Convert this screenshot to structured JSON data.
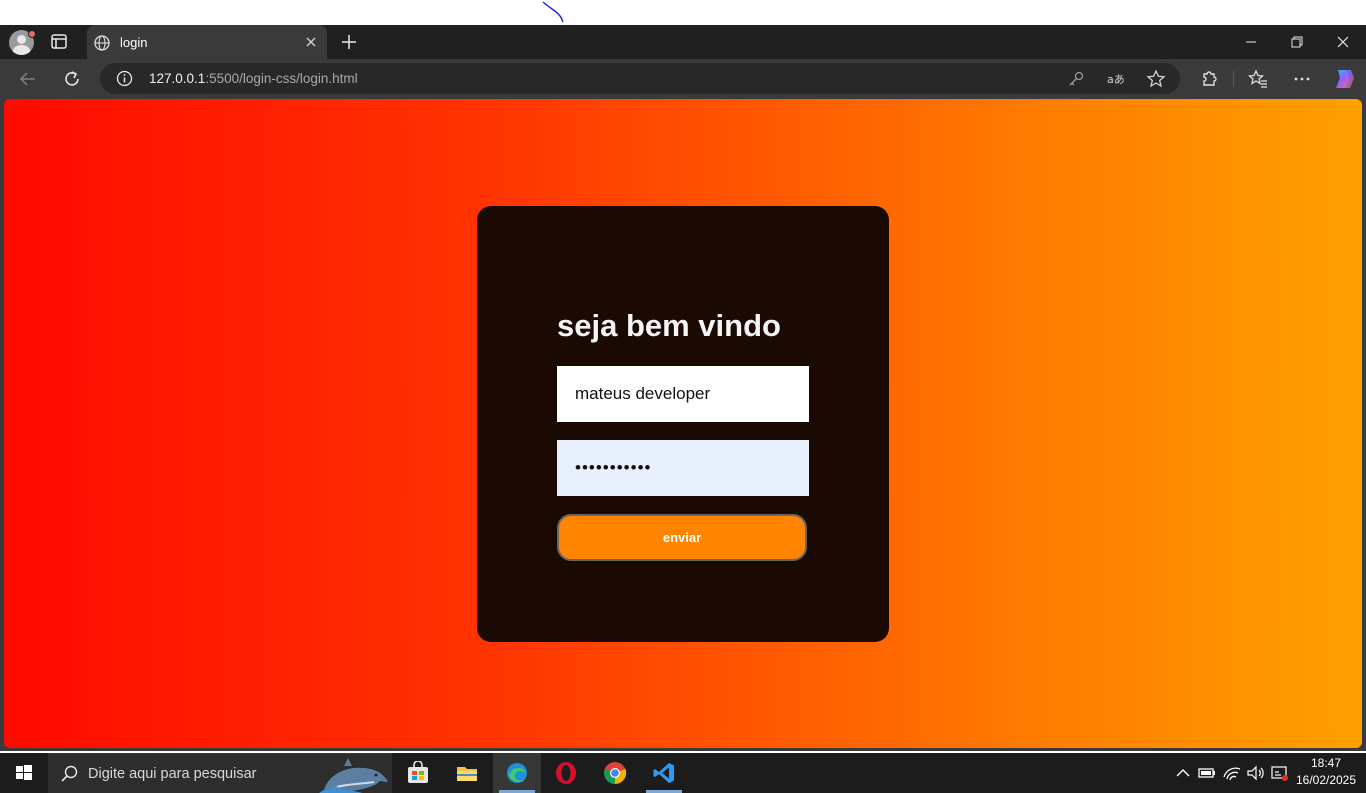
{
  "browser": {
    "tab": {
      "title": "login"
    },
    "address": {
      "host": "127.0.0.1",
      "path": ":5500/login-css/login.html"
    }
  },
  "page": {
    "title": "seja bem vindo",
    "username_value": "mateus developer",
    "password_value": "•••••••••••",
    "submit_label": "enviar",
    "colors": {
      "gradient_start": "#ff0a00",
      "gradient_end": "#ffa000",
      "card": "#1a0a03",
      "button": "#ff8400"
    }
  },
  "taskbar": {
    "search_placeholder": "Digite aqui para pesquisar",
    "clock": {
      "time": "18:47",
      "date": "16/02/2025"
    },
    "apps": [
      "store-icon",
      "file-explorer-icon",
      "edge-icon",
      "opera-icon",
      "chrome-icon",
      "vscode-icon"
    ]
  }
}
